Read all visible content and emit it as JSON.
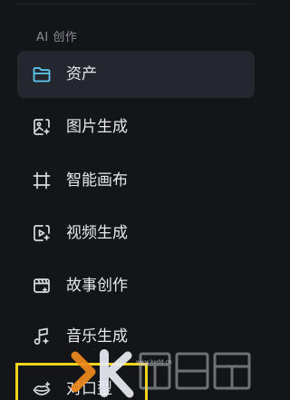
{
  "section": {
    "title": "AI 创作"
  },
  "nav": {
    "items": [
      {
        "label": "资产",
        "icon": "folder-icon",
        "active": true
      },
      {
        "label": "图片生成",
        "icon": "image-spark-icon",
        "active": false
      },
      {
        "label": "智能画布",
        "icon": "canvas-crop-icon",
        "active": false
      },
      {
        "label": "视频生成",
        "icon": "video-spark-icon",
        "active": false
      },
      {
        "label": "故事创作",
        "icon": "clapperboard-icon",
        "active": false
      },
      {
        "label": "音乐生成",
        "icon": "music-note-icon",
        "active": false
      },
      {
        "label": "对口型",
        "icon": "lip-sync-icon",
        "active": false
      }
    ]
  },
  "watermark": {
    "url": "www.kedd.cn",
    "logo": "kedd-watermark-logo"
  },
  "colors": {
    "background": "#141519",
    "active_bg": "#25272e",
    "active_icon": "#5ec8f2",
    "highlight_box": "#f4d31c",
    "watermark_orange": "#f08a1c"
  }
}
